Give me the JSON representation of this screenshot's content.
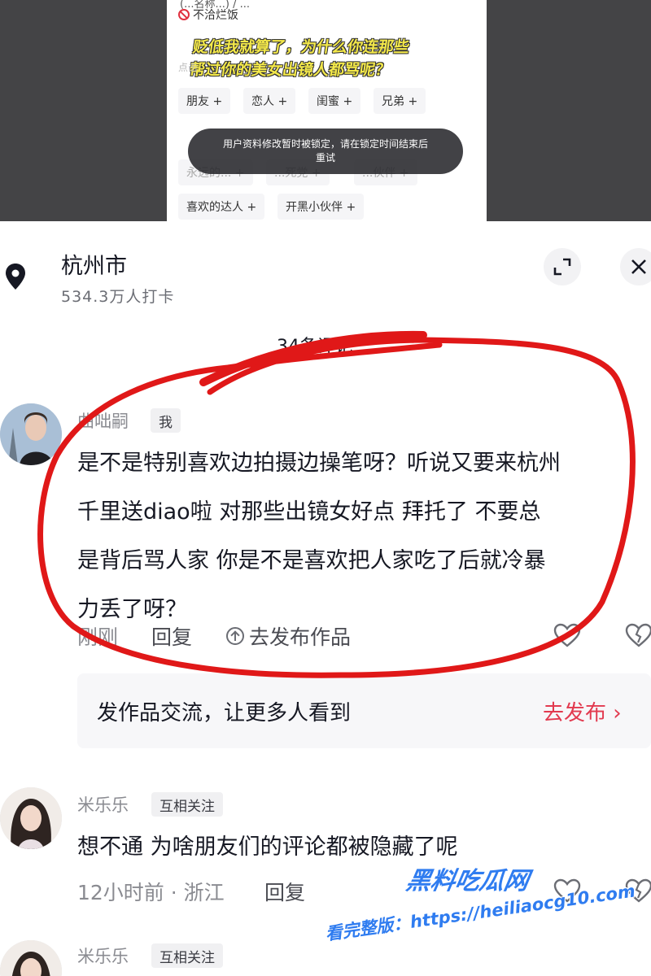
{
  "inner_screenshot": {
    "header_fragment": "(...名称...) / ...",
    "status": "不洽烂饭",
    "caption_line1": "贬低我就算了，为什么你连那些",
    "caption_line2": "帮过你的美女出镜人都骂呢？",
    "hint": "点击",
    "tags": [
      "朋友 +",
      "恋人 +",
      "闺蜜 +",
      "兄弟 +",
      "永远的... +",
      "...死党 +",
      "...伙伴 +",
      "喜欢的达人 +",
      "开黑小伙伴 +"
    ],
    "toast_line1": "用户资料修改暂时被锁定，请在锁定时间结束后",
    "toast_line2": "重试"
  },
  "location": {
    "title": "杭州市",
    "checkins": "534.3万人打卡"
  },
  "comment_count": "34条评论",
  "comments": [
    {
      "name": "曲咄嗣",
      "badge": "我",
      "lines": [
        "是不是特别喜欢边拍摄边操笔呀？听说又要来杭州",
        "千里送diao啦  对那些出镜女好点  拜托了  不要总",
        "是背后骂人家  你是不是喜欢把人家吃了后就冷暴",
        "力丢了呀？"
      ],
      "time": "刚刚",
      "reply": "回复",
      "publish": "去发布作品"
    },
    {
      "name": "米乐乐",
      "badge": "互相关注",
      "text": "想不通  为啥朋友们的评论都被隐藏了呢",
      "time": "12小时前 · 浙江",
      "reply": "回复"
    },
    {
      "name": "米乐乐",
      "badge": "互相关注"
    }
  ],
  "promo": {
    "text": "发作品交流，让更多人看到",
    "cta": "去发布 ›"
  },
  "watermark": {
    "title": "黑料吃瓜网",
    "url": "看完整版：https://heiliaocg10.com"
  },
  "colors": {
    "accent": "#e23a4f",
    "annotation_red": "#e01818",
    "watermark_blue": "#2f7cf0"
  },
  "icons": [
    "location-pin-icon",
    "expand-icon",
    "close-icon",
    "heart-icon",
    "broken-heart-icon",
    "publish-upload-icon",
    "ban-icon"
  ]
}
